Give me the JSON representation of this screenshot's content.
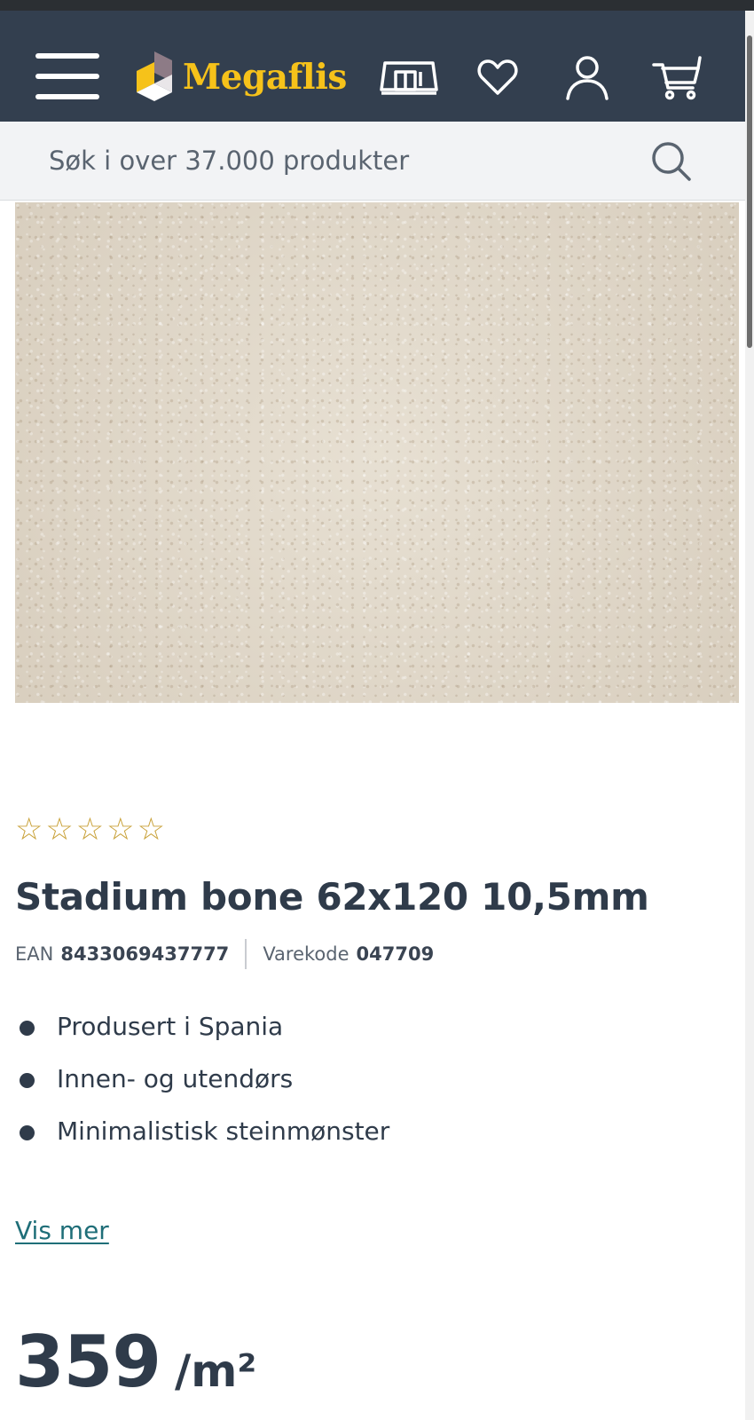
{
  "header": {
    "brand": "Megaflis",
    "icons": [
      "menu-icon",
      "store-icon",
      "heart-icon",
      "user-icon",
      "cart-icon"
    ],
    "colors": {
      "header_bg": "#333f4f",
      "logo_yellow": "#f6c21a",
      "search_bg": "#f2f3f5",
      "link_teal": "#1f6e78"
    }
  },
  "search": {
    "placeholder": "Søk i over 37.000 produkter"
  },
  "product": {
    "rating": {
      "value": 0,
      "max": 5,
      "stars": [
        "☆",
        "☆",
        "☆",
        "☆",
        "☆"
      ]
    },
    "title": "Stadium bone 62x120 10,5mm",
    "ean_label": "EAN",
    "ean": "8433069437777",
    "sku_label": "Varekode",
    "sku": "047709",
    "features": [
      "Produsert i Spania",
      "Innen- og utendørs",
      "Minimalistisk steinmønster"
    ],
    "show_more": "Vis mer",
    "price": "359",
    "price_unit": "/m²"
  }
}
